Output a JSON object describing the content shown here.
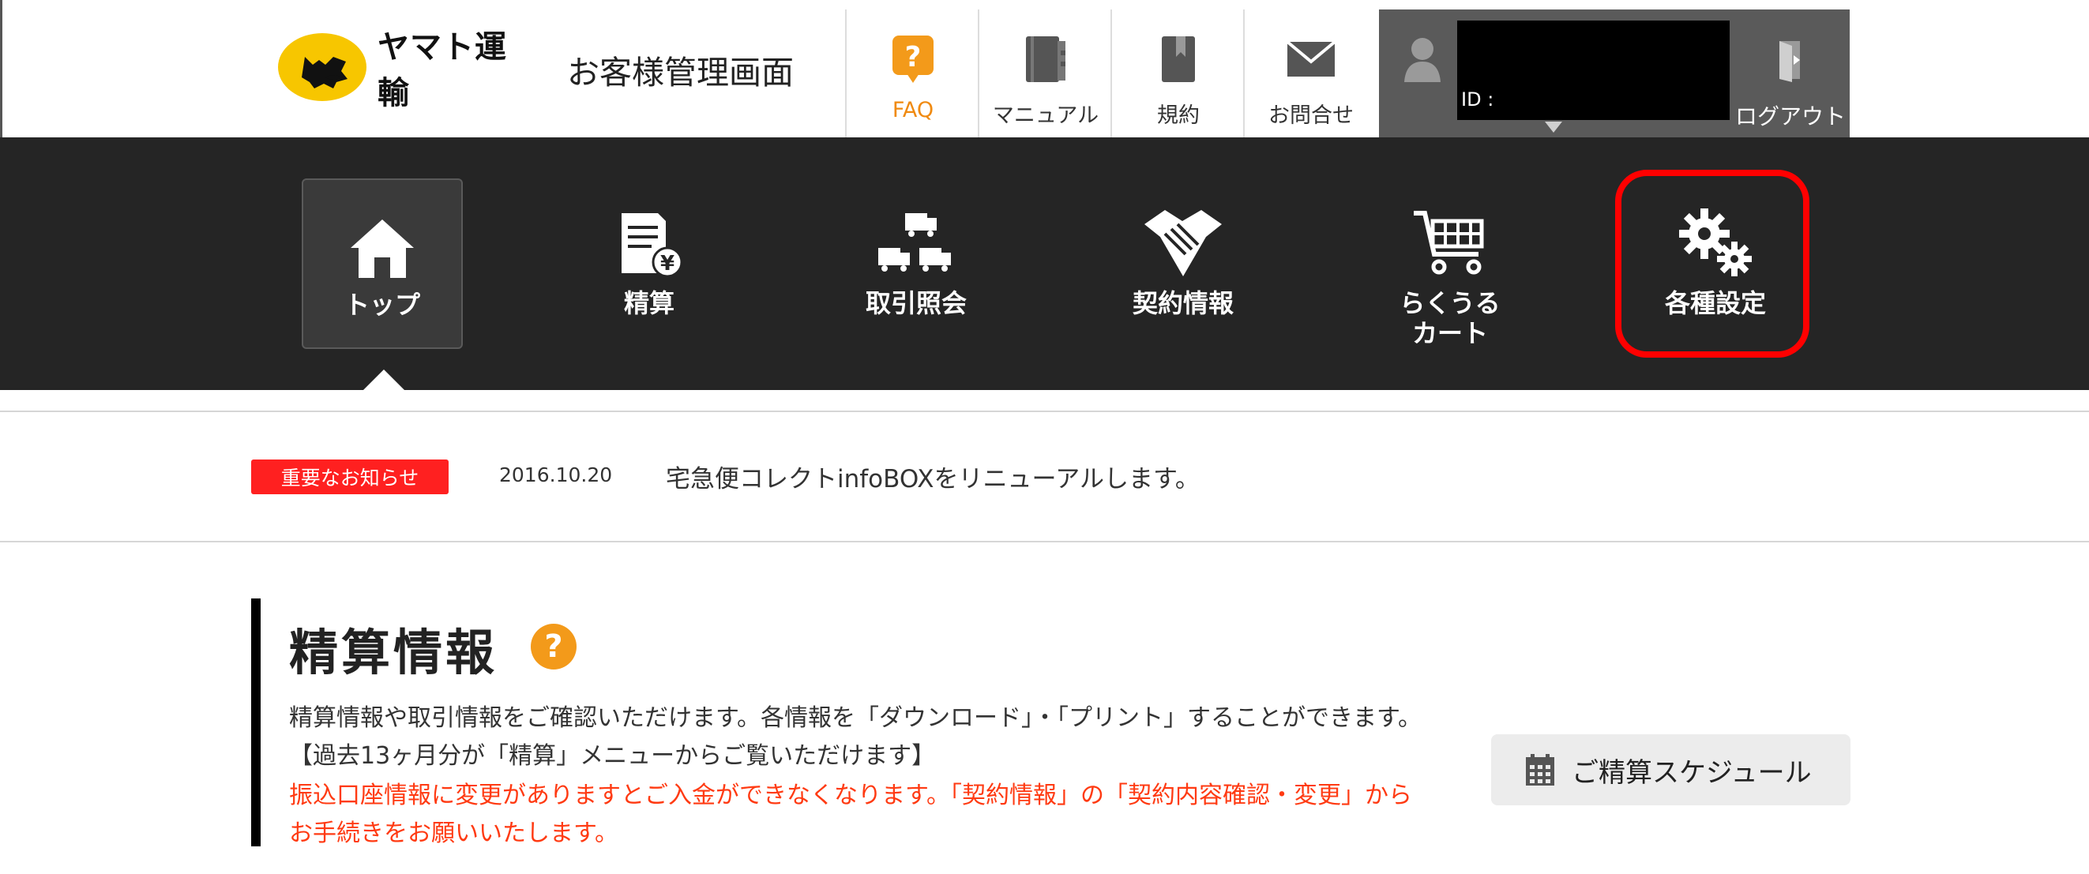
{
  "header": {
    "brand": "ヤマト運輸",
    "site_title": "お客様管理画面",
    "nav": [
      {
        "label": "FAQ",
        "icon": "help-icon"
      },
      {
        "label": "マニュアル",
        "icon": "manual-icon"
      },
      {
        "label": "規約",
        "icon": "terms-icon"
      },
      {
        "label": "お問合せ",
        "icon": "mail-icon"
      }
    ],
    "user": {
      "id_label": "ID :",
      "icon": "user-icon"
    },
    "logout_label": "ログアウト"
  },
  "main_nav": [
    {
      "label": "トップ",
      "icon": "home-icon",
      "active": true
    },
    {
      "label": "精算",
      "icon": "invoice-yen-icon"
    },
    {
      "label": "取引照会",
      "icon": "trucks-icon"
    },
    {
      "label": "契約情報",
      "icon": "handshake-icon"
    },
    {
      "label": "らくうる\nカート",
      "icon": "cart-icon"
    },
    {
      "label": "各種設定",
      "icon": "gears-icon",
      "highlighted": true
    }
  ],
  "notice": {
    "badge": "重要なお知らせ",
    "date": "2016.10.20",
    "text": "宅急便コレクトinfoBOXをリニューアルします。"
  },
  "section": {
    "title": "精算情報",
    "help_glyph": "?",
    "desc_lines": [
      "精算情報や取引情報をご確認いただけます。各情報を「ダウンロード」・「プリント」することができます。",
      "【過去13ヶ月分が「精算」メニューからご覧いただけます】"
    ],
    "warning_lines": [
      "振込口座情報に変更がありますとご入金ができなくなります。「契約情報」の「契約内容確認・変更」から",
      "お手続きをお願いいたします。"
    ],
    "schedule_button": "ご精算スケジュール"
  },
  "colors": {
    "accent_orange": "#f39a1a",
    "nav_bg": "#252525",
    "notice_red": "#ff2020",
    "warning_text": "#ff3a12",
    "highlight_red": "#ff0000"
  }
}
